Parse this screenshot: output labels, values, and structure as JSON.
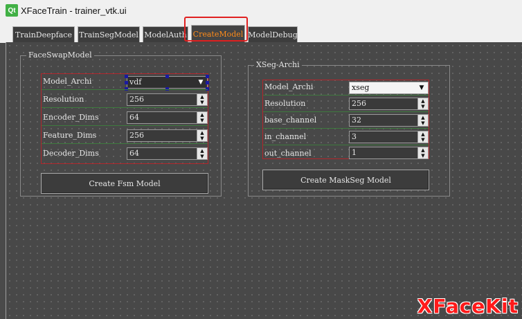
{
  "window": {
    "logo": "Qt",
    "title": "XFaceTrain - trainer_vtk.ui"
  },
  "tabs": [
    {
      "label": "TrainDeepface"
    },
    {
      "label": "TrainSegModel"
    },
    {
      "label": "ModelAuth"
    },
    {
      "label": "CreateModel",
      "active": true
    },
    {
      "label": "ModelDebug"
    }
  ],
  "faceswap": {
    "title": "FaceSwapModel",
    "model_archi": {
      "label": "Model_Archi",
      "value": "vdf"
    },
    "resolution": {
      "label": "Resolution",
      "value": "256"
    },
    "encoder_dims": {
      "label": "Encoder_Dims",
      "value": "64"
    },
    "feature_dims": {
      "label": "Feature_Dims",
      "value": "256"
    },
    "decoder_dims": {
      "label": "Decoder_Dims",
      "value": "64"
    },
    "create_button": "Create Fsm Model"
  },
  "xseg": {
    "title": "XSeg-Archi",
    "model_archi": {
      "label": "Model_Archi",
      "value": "xseg"
    },
    "resolution": {
      "label": "Resolution",
      "value": "256"
    },
    "base_channel": {
      "label": "base_channel",
      "value": "32"
    },
    "in_channel": {
      "label": "in_channel",
      "value": "3"
    },
    "out_channel": {
      "label": "out_channel",
      "value": "1"
    },
    "create_button": "Create MaskSeg Model"
  },
  "watermark": "XFaceKit",
  "colors": {
    "active_tab": "#ff8c1a",
    "highlight": "#e02020",
    "watermark": "#ff1a1a"
  }
}
